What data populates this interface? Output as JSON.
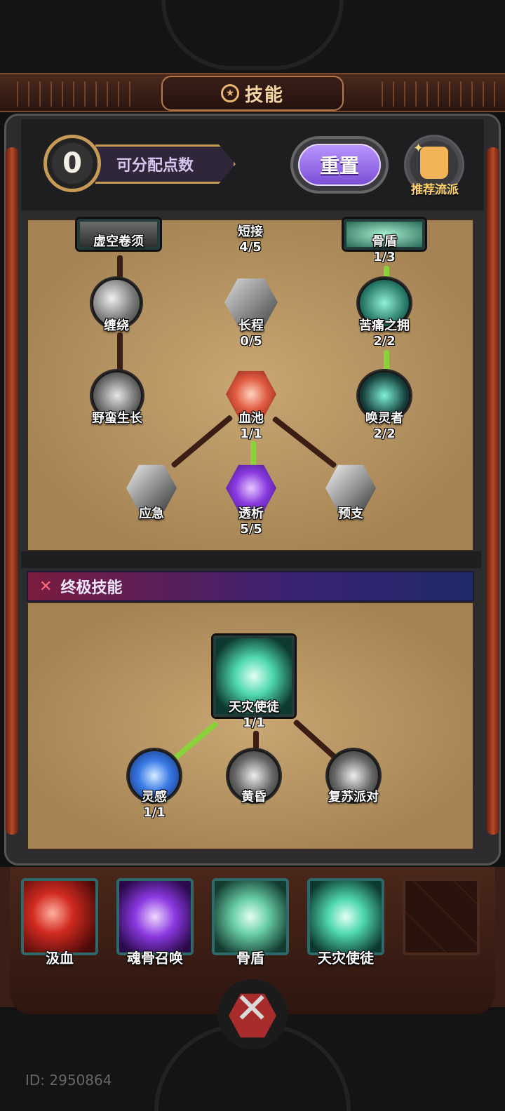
{
  "header": {
    "title": "技能",
    "title_icon": "pentagram-icon"
  },
  "points": {
    "value": "0",
    "label": "可分配点数"
  },
  "buttons": {
    "reset": "重置",
    "recommend": "推荐流派"
  },
  "tree": {
    "nodes": [
      {
        "name": "虚空卷须",
        "level": ""
      },
      {
        "name": "短接",
        "level": "4/5"
      },
      {
        "name": "骨盾",
        "level": "1/3"
      },
      {
        "name": "缠绕",
        "level": ""
      },
      {
        "name": "长程",
        "level": "0/5"
      },
      {
        "name": "苦痛之拥",
        "level": "2/2"
      },
      {
        "name": "野蛮生长",
        "level": ""
      },
      {
        "name": "血池",
        "level": "1/1"
      },
      {
        "name": "唤灵者",
        "level": "2/2"
      },
      {
        "name": "应急",
        "level": ""
      },
      {
        "name": "透析",
        "level": "5/5"
      },
      {
        "name": "预支",
        "level": ""
      }
    ]
  },
  "ultimate": {
    "section_label": "终极技能",
    "nodes": [
      {
        "name": "天灾使徒",
        "level": "1/1"
      },
      {
        "name": "灵感",
        "level": "1/1"
      },
      {
        "name": "黄昏",
        "level": ""
      },
      {
        "name": "复苏派对",
        "level": ""
      }
    ]
  },
  "equipped": [
    {
      "name": "汲血"
    },
    {
      "name": "魂骨召唤"
    },
    {
      "name": "骨盾"
    },
    {
      "name": "天灾使徒"
    },
    {
      "name": ""
    }
  ],
  "footer": {
    "id": "ID: 2950864"
  },
  "colors": {
    "active_link": "#8bd13a",
    "inactive_link": "#3a1e14",
    "reset_purple": "#9a70ee",
    "gold": "#c79a55"
  }
}
